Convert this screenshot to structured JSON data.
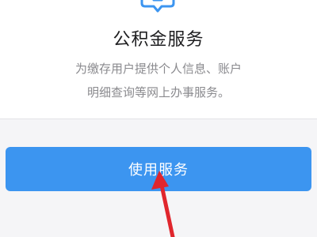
{
  "service": {
    "title": "公积金服务",
    "description_lines": [
      "为缴存用户提供个人信息、账户",
      "明细查询等网上办事服务。"
    ]
  },
  "action": {
    "button_label": "使用服务"
  },
  "icons": {
    "service_icon": "chat-bubble-icon",
    "annotation": "red-arrow-annotation"
  },
  "colors": {
    "accent": "#3c95f0",
    "annotation": "#e0262d"
  }
}
